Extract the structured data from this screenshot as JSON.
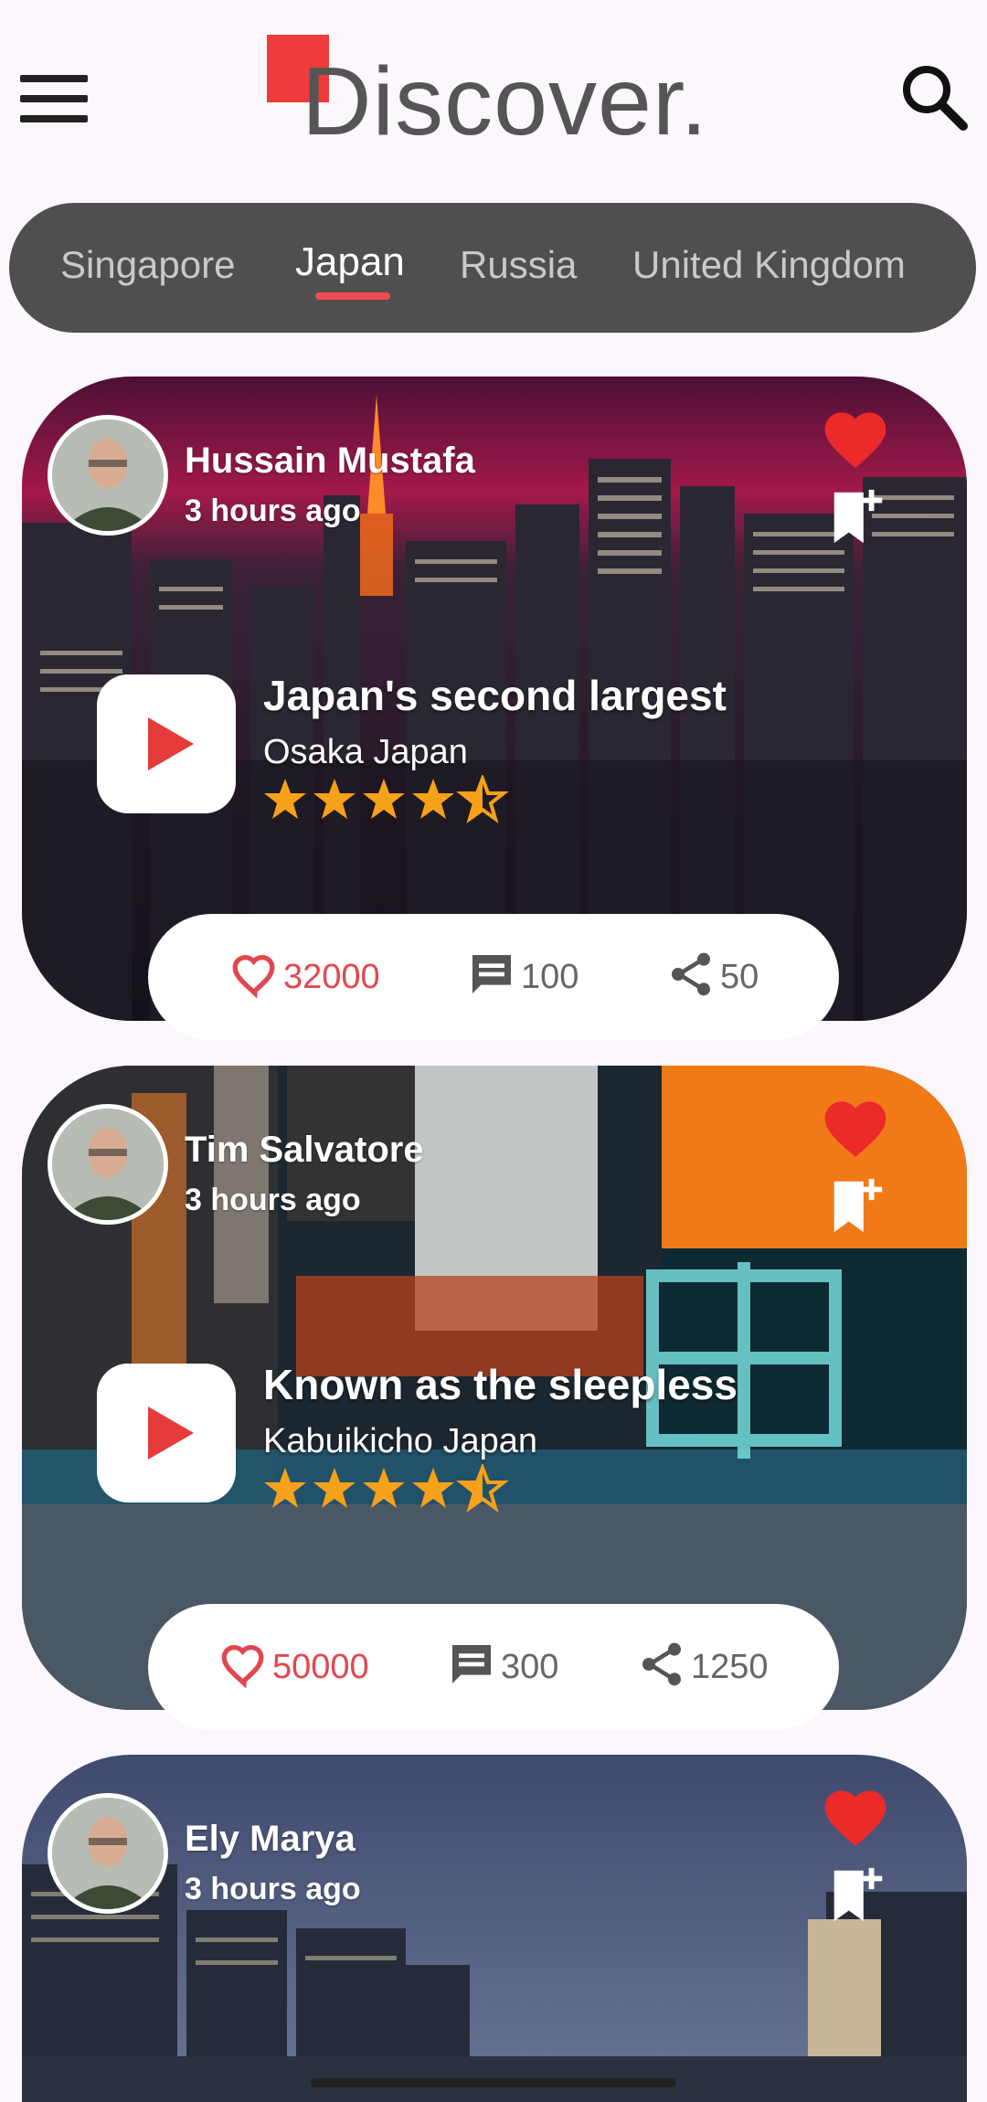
{
  "header": {
    "logo_text": "Discover.",
    "menu_icon": "hamburger-menu-icon",
    "search_icon": "search-icon",
    "brand_color": "#ef3b3b"
  },
  "tabs": {
    "items": [
      {
        "label": "Singapore",
        "active": false
      },
      {
        "label": "Japan",
        "active": true
      },
      {
        "label": "Russia",
        "active": false
      },
      {
        "label": "United Kingdom",
        "active": false
      }
    ]
  },
  "posts": [
    {
      "user": "Hussain Mustafa",
      "time": "3 hours ago",
      "title": "Japan's second largest",
      "location": "Osaka Japan",
      "rating": 4.5,
      "likes": "32000",
      "comments": "100",
      "shares": "50"
    },
    {
      "user": "Tim Salvatore",
      "time": "3 hours ago",
      "title": "Known as the sleepless",
      "location": "Kabuikicho Japan",
      "rating": 4.5,
      "likes": "50000",
      "comments": "300",
      "shares": "1250"
    },
    {
      "user": "Ely Marya",
      "time": "3 hours ago"
    }
  ],
  "colors": {
    "accent": "#ef3b3b",
    "like": "#e2474f",
    "star": "#f7a11a",
    "tabbar": "#4f4f4f"
  }
}
